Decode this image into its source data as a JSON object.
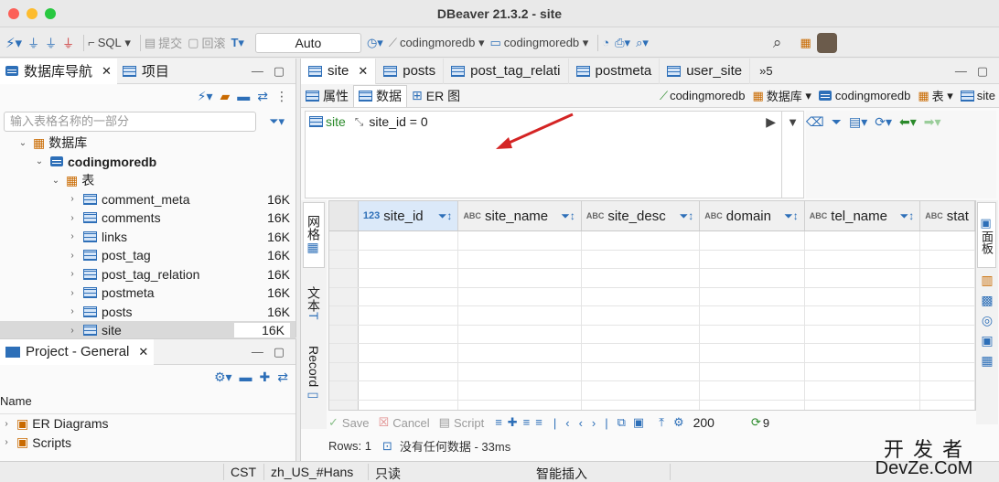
{
  "window": {
    "title": "DBeaver 21.3.2 - site"
  },
  "toolbar": {
    "sql_label": "SQL",
    "commit_label": "提交",
    "rollback_label": "回滚",
    "transaction_mode": "Auto",
    "datasource1": "codingmoredb",
    "datasource2": "codingmoredb"
  },
  "nav": {
    "tab_db": "数据库导航",
    "tab_project": "项目",
    "filter_placeholder": "输入表格名称的一部分",
    "node_database": "数据库",
    "node_schema": "codingmoredb",
    "node_tables": "表",
    "tables": [
      {
        "name": "comment_meta",
        "size": "16K"
      },
      {
        "name": "comments",
        "size": "16K"
      },
      {
        "name": "links",
        "size": "16K"
      },
      {
        "name": "post_tag",
        "size": "16K"
      },
      {
        "name": "post_tag_relation",
        "size": "16K"
      },
      {
        "name": "postmeta",
        "size": "16K"
      },
      {
        "name": "posts",
        "size": "16K"
      },
      {
        "name": "site",
        "size": "16K"
      }
    ]
  },
  "project": {
    "title": "Project - General",
    "col_name": "Name",
    "items": [
      "ER Diagrams",
      "Scripts"
    ]
  },
  "editor": {
    "tabs": [
      "site",
      "posts",
      "post_tag_relati",
      "postmeta",
      "user_site"
    ],
    "tabs_more": "»5",
    "subtabs": {
      "properties": "属性",
      "data": "数据",
      "er": "ER 图"
    },
    "crumbs": {
      "conn": "codingmoredb",
      "db": "数据库",
      "schema": "codingmoredb",
      "tables": "表",
      "table": "site"
    },
    "filter_entity": "site",
    "filter_text": "site_id = 0",
    "columns": [
      {
        "type": "123",
        "name": "site_id"
      },
      {
        "type": "ABC",
        "name": "site_name"
      },
      {
        "type": "ABC",
        "name": "site_desc"
      },
      {
        "type": "ABC",
        "name": "domain"
      },
      {
        "type": "ABC",
        "name": "tel_name"
      },
      {
        "type": "ABC",
        "name": "stat"
      }
    ],
    "side_tabs": {
      "grid": "网格",
      "text": "文本",
      "record": "Record"
    },
    "right_tab": "面板",
    "bottom": {
      "save": "Save",
      "cancel": "Cancel",
      "script": "Script",
      "fetch_size": "200",
      "page": "9"
    },
    "status_rows": "Rows: 1",
    "status_msg": "没有任何数据 - 33ms"
  },
  "statusbar": {
    "tz": "CST",
    "locale": "zh_US_#Hans",
    "readonly": "只读",
    "insert": "智能插入"
  },
  "watermark": {
    "top": "开 发 者",
    "bottom": "DevZe.CoM"
  },
  "colors": {
    "accent": "#2d6fb8",
    "arrow": "#d42424"
  }
}
